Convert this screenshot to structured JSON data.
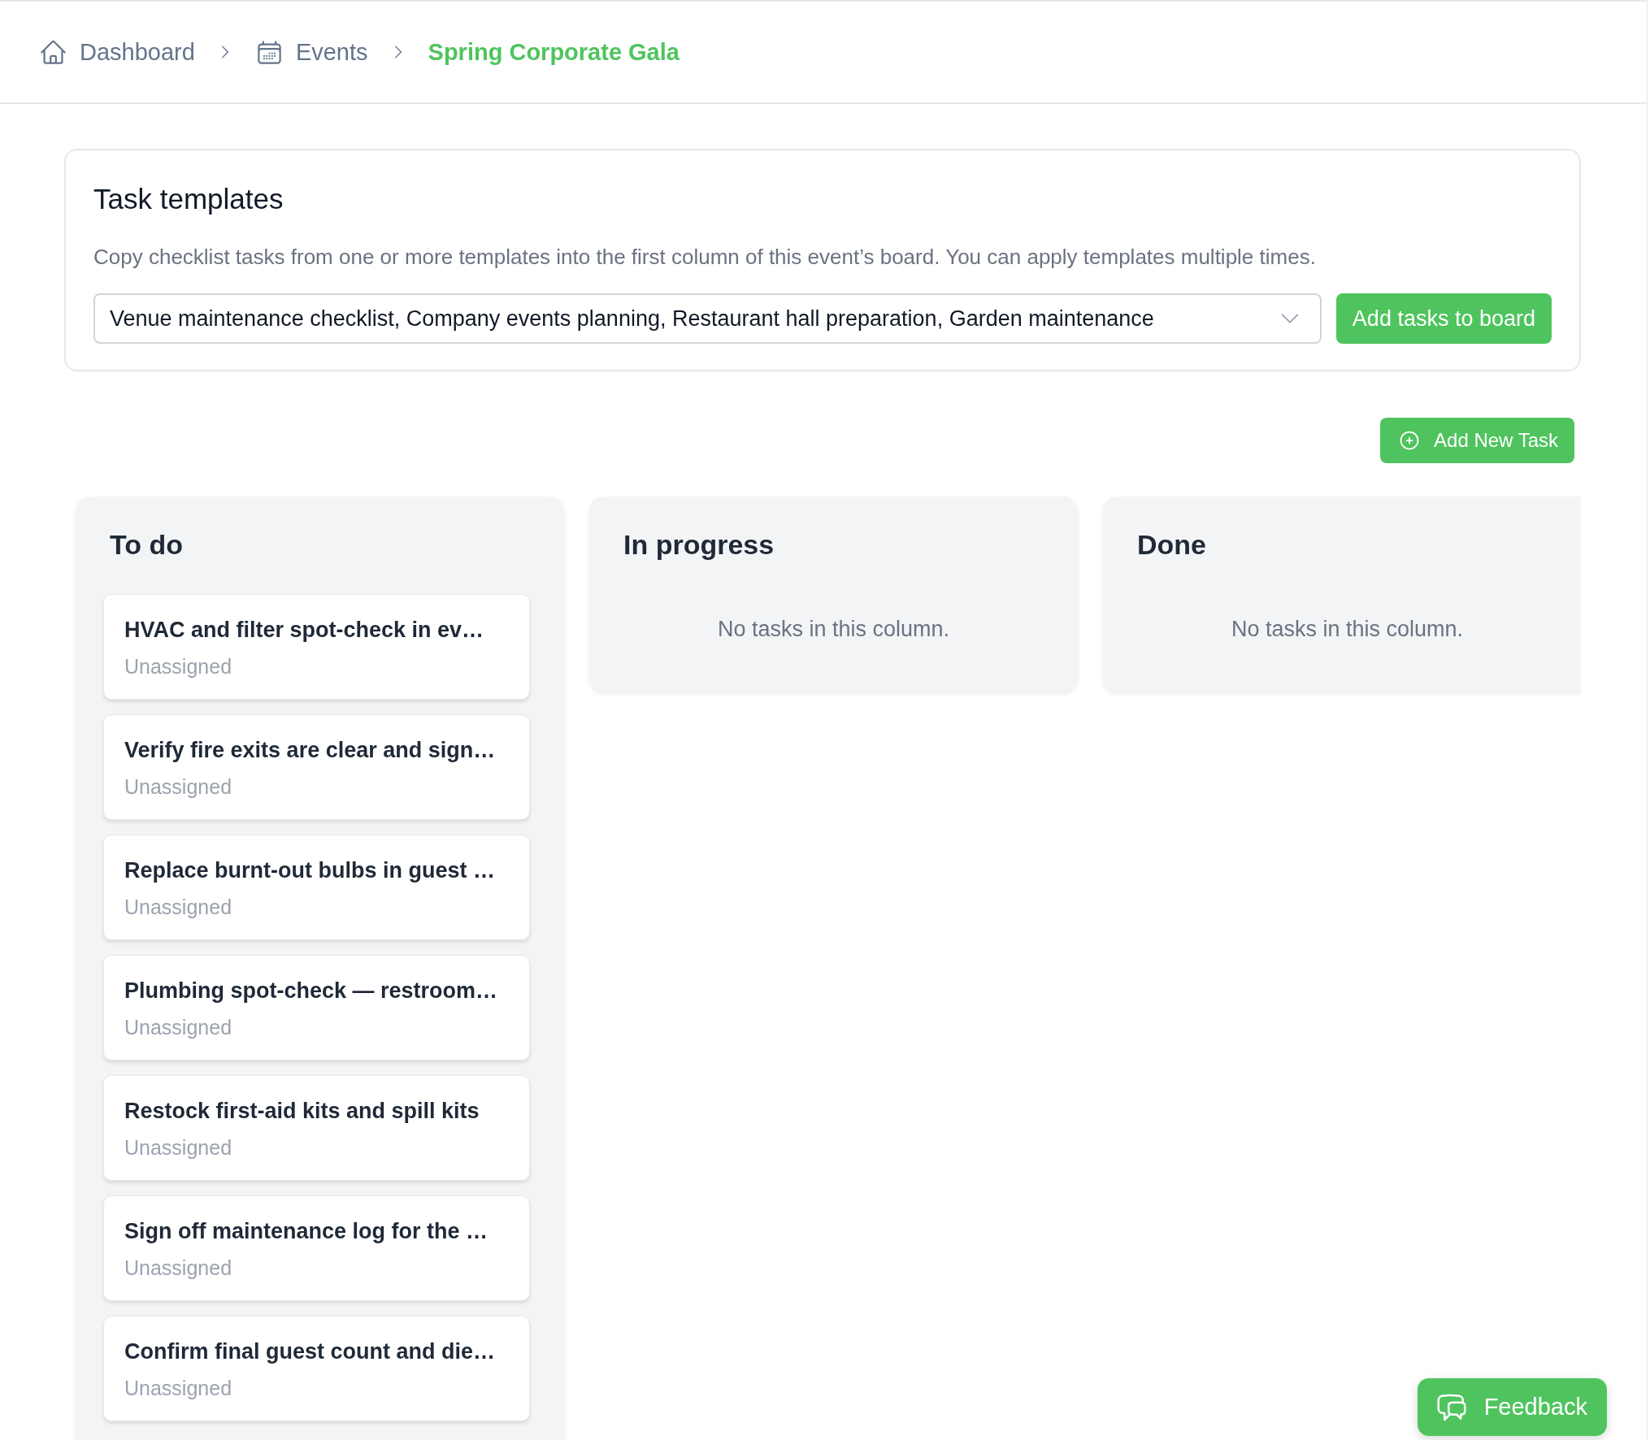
{
  "breadcrumb": [
    {
      "label": "Dashboard",
      "current": false
    },
    {
      "label": "Events",
      "current": false
    },
    {
      "label": "Spring Corporate Gala",
      "current": true
    }
  ],
  "task_templates": {
    "title": "Task templates",
    "description": "Copy checklist tasks from one or more templates into the first column of this event’s board. You can apply templates multiple times.",
    "select": {
      "value": "Venue maintenance checklist, Company events planning, Restaurant hall preparation, Garden maintenance"
    },
    "button": "Add tasks to board"
  },
  "add_task_button": "Add New Task",
  "board": {
    "columns": [
      {
        "title": "To do",
        "tasks": [
          {
            "title": "HVAC and filter spot-check in ev…",
            "assignee": "Unassigned"
          },
          {
            "title": "Verify fire exits are clear and sign…",
            "assignee": "Unassigned"
          },
          {
            "title": "Replace burnt-out bulbs in guest …",
            "assignee": "Unassigned"
          },
          {
            "title": "Plumbing spot-check — restroom…",
            "assignee": "Unassigned"
          },
          {
            "title": "Restock first-aid kits and spill kits",
            "assignee": "Unassigned"
          },
          {
            "title": "Sign off maintenance log for the …",
            "assignee": "Unassigned"
          },
          {
            "title": "Confirm final guest count and die…",
            "assignee": "Unassigned"
          }
        ]
      },
      {
        "title": "In progress",
        "empty_message": "No tasks in this column."
      },
      {
        "title": "Done",
        "empty_message": "No tasks in this column."
      }
    ]
  },
  "feedback_button": "Feedback"
}
